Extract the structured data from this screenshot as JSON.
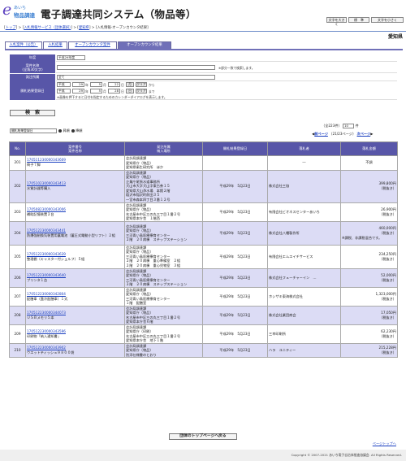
{
  "header": {
    "logo_mark": "e",
    "logo_line1": "あいち",
    "logo_line2": "物品調達",
    "title": "電子調達共同システム（物品等）",
    "btn_font": "文字を大きく",
    "btn_std": "標　準",
    "btn_small": "文字を小さく"
  },
  "breadcrumb": {
    "top": "トップ",
    "svc": "入札情報サービス（団体選択）",
    "pref": "愛知県",
    "current": "入札情報-オープンカウンタ結果"
  },
  "prefecture": "愛知県",
  "tabs": [
    "入札案件（公告）",
    "入札結果",
    "オープンカウンタ案件",
    "オープンカウンタ結果"
  ],
  "search": {
    "labels": {
      "year": "年度",
      "case_name": "案件名称",
      "case_name2": "(全角30文字)",
      "org": "発注所属",
      "date": "開札結果登録日"
    },
    "year_value": "平成29年度",
    "case_name_note": "※部分一致で検索します。",
    "org_value": "全て",
    "date_from": {
      "era": "平成",
      "y": "29",
      "y_u": "年",
      "m": "5",
      "m_u": "月",
      "d": "22",
      "d_u": "日",
      "cal": "月",
      "clear": "クリア",
      "suffix": "から"
    },
    "date_to": {
      "era": "平成",
      "y": "29",
      "y_u": "年",
      "m": "5",
      "m_u": "月",
      "d": "28",
      "d_u": "日",
      "cal": "日",
      "clear": "クリア",
      "suffix": "まで"
    },
    "date_note": "※画像を押下すると日付を指定するためのカレンダーダイアログを表示します。",
    "button": "検　索"
  },
  "results": {
    "sort_value": "開札結果登録日",
    "asc": "昇順",
    "desc": "降順",
    "count_text": "（全223件）",
    "per_page": "10",
    "per_text": "件",
    "prev": "前ページ",
    "page_info": "（21/23ページ）",
    "next": "次ページ",
    "columns": [
      "No.",
      "案件番号\n案件名称",
      "発注所属\n納入場所",
      "開札結果登録日",
      "落札者",
      "落札金額"
    ],
    "rows": [
      {
        "no": "201",
        "id": "170511230000343609",
        "name": "椅子７脚",
        "org": [
          "会計局調達課\n愛知県庁（物品）",
          "愛知県衛生研究所　ほか"
        ],
        "date": "",
        "winner": "―",
        "amount": "",
        "amount_note": "不調"
      },
      {
        "no": "202",
        "id": "170510230000343413",
        "name": "水質計器等購入",
        "org": [
          "会計局調達課\n愛知県庁（物品）",
          "企業庁尾張水道事務所",
          "犬山市大字犬山字東古券１５",
          "愛知県犬山浄水場　本館２階",
          "稲沢市稲沢町前田３５",
          "一宮市森本四丁目３番１２号"
        ],
        "date": "平成29年　5月23日",
        "winner": "株式会社三協",
        "amount": "399,800円",
        "amount_note": "（税抜き）"
      },
      {
        "no": "203",
        "id": "170508230000343006",
        "name": "補助記憶装置２台",
        "org": [
          "会計局調達課\n愛知県庁（物品）",
          "名古屋市中区三の丸三丁目１番２号",
          "愛知県本庁舎　１階西"
        ],
        "date": "平成29年　5月23日",
        "winner": "有限会社ビオネスセンターあいち",
        "amount": "26,900円",
        "amount_note": "（税抜き）"
      },
      {
        "no": "204",
        "id": "170512230000343441",
        "name": "防爆強制換気装置用蓄電池（蓄圧式電動小型リフト）２組",
        "org": [
          "会計局調達課\n愛知県庁（物品）",
          "三河青い鳥医療療育センター",
          "２階　２０病棟　ステップステーション"
        ],
        "date": "平成29年　5月23日",
        "winner": "株式会社八幡製作所",
        "amount": "460,000円",
        "amount_note": "（税抜き）",
        "amount_extra": "※課税、非課税混合です。"
      },
      {
        "no": "205",
        "id": "170512230000343639",
        "name": "整理棚（キャスター付シェルフ）５組",
        "org": [
          "会計局調達課\n愛知県庁（物品）",
          "三河青い鳥医療療育センター",
          "２階　２０病棟　重心準備室　２組",
          "２階　２０病棟　重心児物室　３組"
        ],
        "date": "平成29年　5月23日",
        "winner": "有限会社エムエイチサービス",
        "amount": "234,250円",
        "amount_note": "（税抜き）"
      },
      {
        "no": "206",
        "id": "170512230000343640",
        "name": "プリンタ１台",
        "org": [
          "会計局調達課\n愛知県庁（物品）",
          "三河青い鳥医療療育センター",
          "２階　２０病棟　ステップステーション"
        ],
        "date": "平成29年　5月23日",
        "winner": "株式会社フューチャーイン　…",
        "amount": "52,000円",
        "amount_note": "（税抜き）"
      },
      {
        "no": "207",
        "id": "170512230000342804",
        "name": "配膳車（蓋冷配膳車）１式",
        "org": [
          "会計局調達課\n愛知県庁（物品）",
          "三河青い鳥医療療育センター",
          "１階　配膳室"
        ],
        "date": "平成29年　5月23日",
        "winner": "ホシザキ東海株式会社",
        "amount": "1,323,000円",
        "amount_note": "（税抜き）"
      },
      {
        "no": "208",
        "id": "170512230000344073",
        "name": "ＵＳＢメモリ５本",
        "org": [
          "会計局調達課\n愛知県庁（物品）",
          "名古屋市中区三の丸三丁目１番２号",
          "愛知県本庁舎６階"
        ],
        "date": "平成29年　5月23日",
        "winner": "株式会社業団商会",
        "amount": "17,050円",
        "amount_note": "（税抜き）"
      },
      {
        "no": "209",
        "id": "170512230000343596",
        "name": "印刷物「納入通知書」",
        "org": [
          "会計局調達課\n愛知県庁（印刷）",
          "名古屋市中区三の丸三丁目１番２号",
          "愛知県本庁舎　地下１階"
        ],
        "date": "平成29年　5月23日",
        "winner": "三幸印刷所",
        "amount": "62,230円",
        "amount_note": "（税抜き）"
      },
      {
        "no": "210",
        "id": "170512230000343902",
        "name": "ウエットティッシュ９８００袋",
        "org": [
          "会計局調達課\n愛知県庁（物品）",
          "別添仕様書のとおり"
        ],
        "date": "平成29年　5月23日",
        "winner": "ハラ　ユニティー",
        "amount": "215,228円",
        "amount_note": "（税抜き）"
      }
    ]
  },
  "back_button": "団体のトップページへ戻る",
  "page_top": "ページトップへ",
  "copyright": "Copyright © 2007-2021 あいち電子自治体推進協議会. All Rights Reserved."
}
